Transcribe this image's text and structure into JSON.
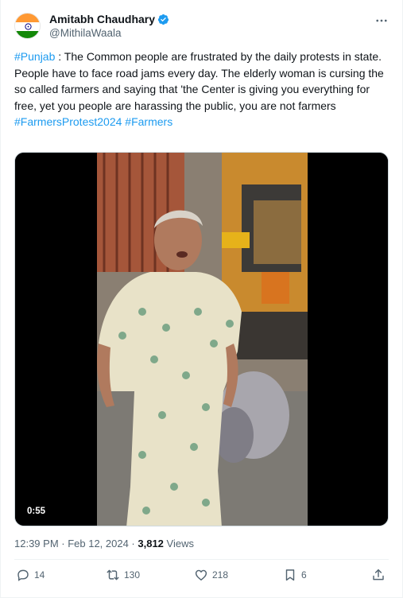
{
  "author": {
    "name": "Amitabh Chaudhary",
    "handle": "@MithilaWaala"
  },
  "tweet": {
    "hashtag_lead": "#Punjab",
    "body": " : The Common people are frustrated by the daily protests in state. People have to face road jams every day. The elderly woman is cursing the so called farmers and saying that 'the Center is giving you everything for free, yet you people are harassing the public, you are not farmers",
    "hashtag_1": "#FarmersProtest2024",
    "hashtag_2": "#Farmers"
  },
  "media": {
    "duration": "0:55"
  },
  "meta": {
    "time_date": "12:39 PM · Feb 12, 2024 · ",
    "views_count": "3,812",
    "views_label": " Views"
  },
  "actions": {
    "replies": "14",
    "reposts": "130",
    "likes": "218",
    "bookmarks": "6"
  },
  "colors": {
    "link": "#1d9bf0",
    "secondary": "#536471",
    "verified": "#1d9bf0"
  }
}
